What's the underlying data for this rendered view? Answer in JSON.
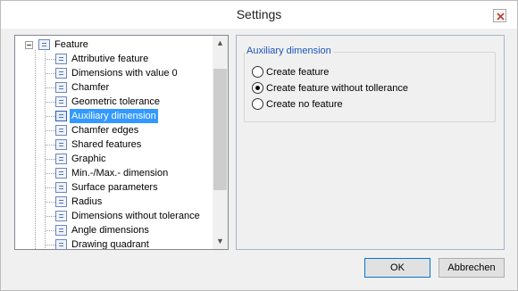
{
  "window": {
    "title": "Settings"
  },
  "tree": {
    "root_label": "Feature",
    "items": [
      {
        "label": "Attributive feature"
      },
      {
        "label": "Dimensions with value 0"
      },
      {
        "label": "Chamfer"
      },
      {
        "label": "Geometric tolerance"
      },
      {
        "label": "Auxiliary dimension",
        "selected": true
      },
      {
        "label": "Chamfer edges"
      },
      {
        "label": "Shared features"
      },
      {
        "label": "Graphic"
      },
      {
        "label": "Min.-/Max.- dimension"
      },
      {
        "label": "Surface parameters"
      },
      {
        "label": "Radius"
      },
      {
        "label": "Dimensions without tolerance"
      },
      {
        "label": "Angle dimensions"
      },
      {
        "label": "Drawing quadrant"
      }
    ],
    "scroll_up_glyph": "▲",
    "scroll_down_glyph": "▼"
  },
  "group": {
    "title": "Auxiliary dimension",
    "options": [
      {
        "label": "Create feature",
        "checked": false
      },
      {
        "label": "Create feature without tollerance",
        "checked": true
      },
      {
        "label": "Create no feature",
        "checked": false
      }
    ]
  },
  "buttons": {
    "ok": "OK",
    "cancel": "Abbrechen"
  },
  "colors": {
    "selection": "#3399ff",
    "group_title": "#1a56b8"
  }
}
